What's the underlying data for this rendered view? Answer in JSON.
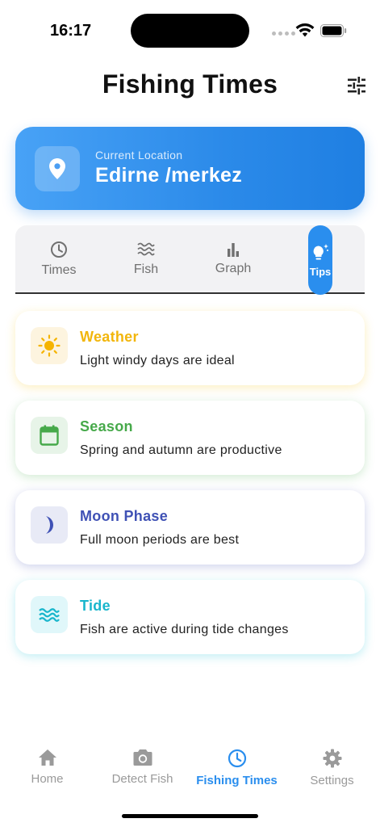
{
  "status_bar": {
    "time": "16:17"
  },
  "header": {
    "title": "Fishing Times",
    "filter_icon": "tune-icon"
  },
  "location": {
    "caption": "Current Location",
    "name": "Edirne /merkez",
    "icon": "location-pin-icon"
  },
  "tabs": [
    {
      "label": "Times",
      "icon": "clock-icon",
      "active": false
    },
    {
      "label": "Fish",
      "icon": "waves-icon",
      "active": false
    },
    {
      "label": "Graph",
      "icon": "bar-chart-icon",
      "active": false
    },
    {
      "label": "Tips",
      "icon": "lightbulb-icon",
      "active": true
    }
  ],
  "tips": [
    {
      "title": "Weather",
      "description": "Light windy days are ideal",
      "icon": "sun-icon",
      "color": "#f2b60c"
    },
    {
      "title": "Season",
      "description": "Spring and autumn are productive",
      "icon": "calendar-icon",
      "color": "#46a94a"
    },
    {
      "title": "Moon Phase",
      "description": "Full moon periods are best",
      "icon": "moon-icon",
      "color": "#3f51b5"
    },
    {
      "title": "Tide",
      "description": "Fish are active during tide changes",
      "icon": "waves-icon",
      "color": "#19b6cc"
    }
  ],
  "bottom_nav": [
    {
      "label": "Home",
      "icon": "home-icon",
      "active": false
    },
    {
      "label": "Detect Fish",
      "icon": "camera-icon",
      "active": false
    },
    {
      "label": "Fishing Times",
      "icon": "clock-icon",
      "active": true
    },
    {
      "label": "Settings",
      "icon": "gear-icon",
      "active": false
    }
  ],
  "colors": {
    "accent": "#2a8eee",
    "inactive": "#9a9a9a"
  }
}
